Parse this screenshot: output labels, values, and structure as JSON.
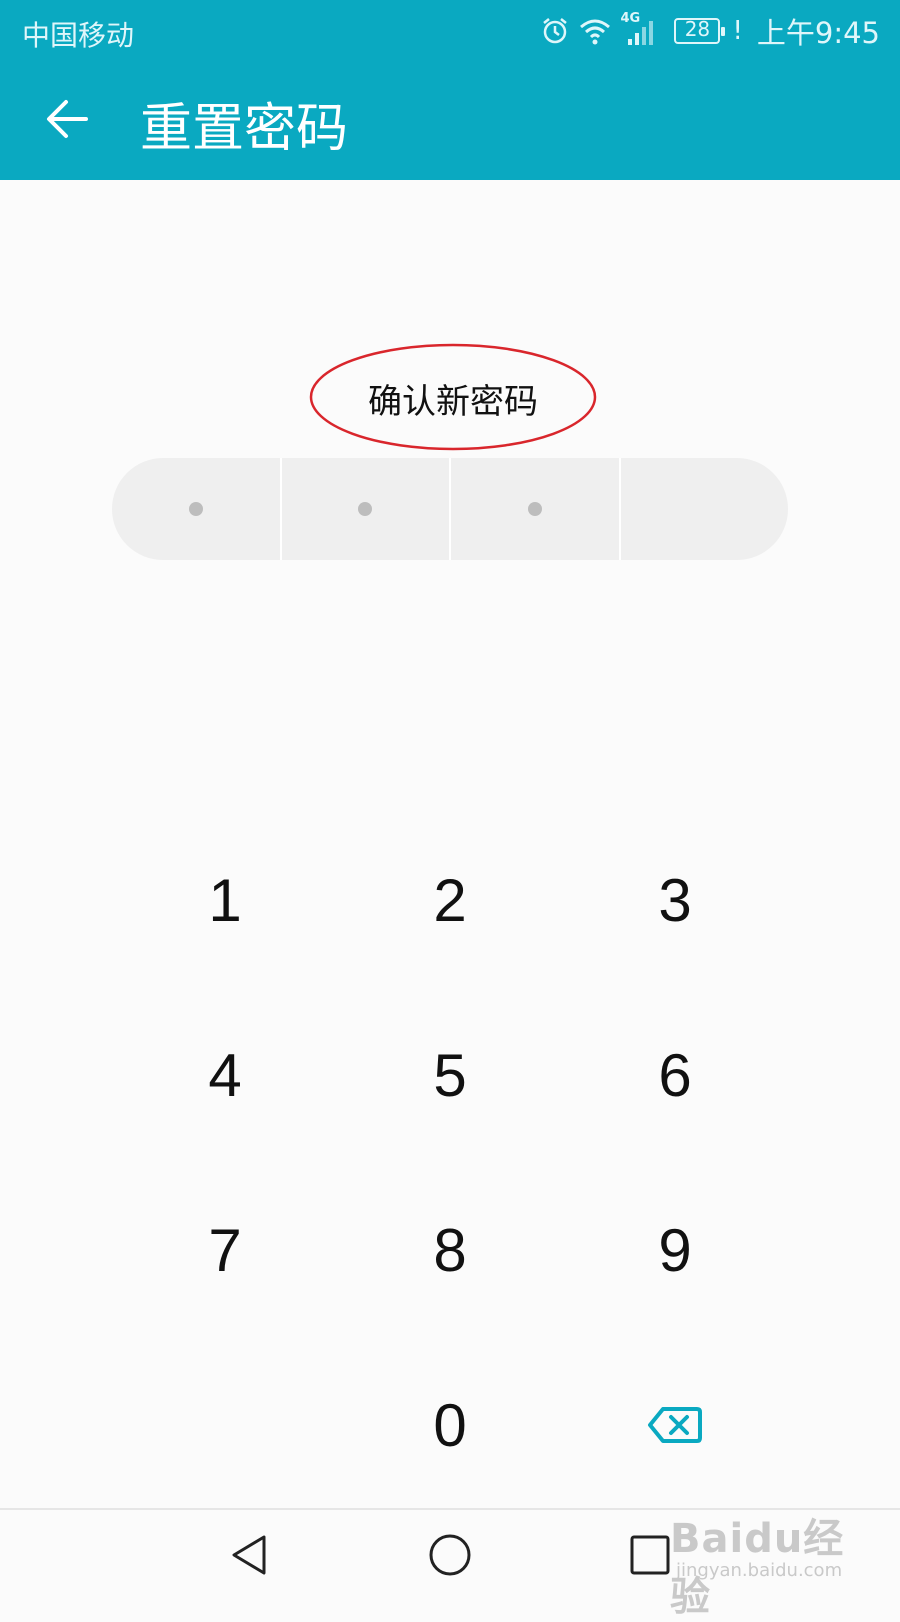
{
  "status_bar": {
    "carrier": "中国移动",
    "network": "4G",
    "battery": "28",
    "alert": "!",
    "time": "上午9:45"
  },
  "header": {
    "title": "重置密码"
  },
  "prompt": {
    "text": "确认新密码",
    "highlight_color": "#d9262c"
  },
  "pin": {
    "length": 4,
    "entered": 3
  },
  "keypad": {
    "keys": [
      "1",
      "2",
      "3",
      "4",
      "5",
      "6",
      "7",
      "8",
      "9",
      "0"
    ],
    "delete_icon": "backspace-icon"
  },
  "nav_bar": {
    "icons": [
      "back-triangle-icon",
      "home-circle-icon",
      "recents-square-icon"
    ]
  },
  "watermark": {
    "logo_text": "Baidu经验",
    "url": "jingyan.baidu.com"
  },
  "colors": {
    "accent": "#0aa9c1",
    "pin_box": "#efefef",
    "pin_dot": "#bdbdbd"
  }
}
